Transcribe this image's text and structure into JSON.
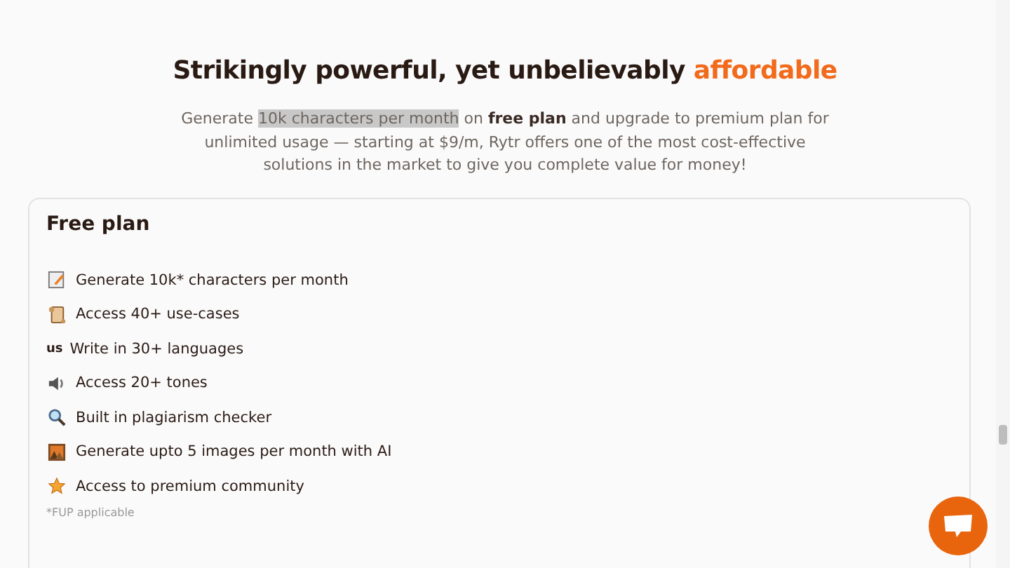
{
  "heading": {
    "text": "Strikingly powerful, yet unbelievably ",
    "accent": "affordable"
  },
  "intro": [
    {
      "text": "Generate ",
      "highlighted": false,
      "bold": false
    },
    {
      "text": "10k characters per month",
      "highlighted": true,
      "bold": false
    },
    {
      "text": " on ",
      "highlighted": false,
      "bold": false
    },
    {
      "text": "free plan",
      "highlighted": false,
      "bold": true
    },
    {
      "text": " and upgrade to premium plan for unlimited usage — starting at $9/m, Rytr offers one of the most cost-effective solutions in the market to give you complete value for money!",
      "highlighted": false,
      "bold": false
    }
  ],
  "plan": {
    "title": "Free plan",
    "features": [
      {
        "kind": "note",
        "label": "Generate 10k* characters per month"
      },
      {
        "kind": "scroll",
        "label": "Access 40+ use-cases"
      },
      {
        "kind": "text",
        "icon_text": "us",
        "label": "Write in 30+ languages"
      },
      {
        "kind": "speaker",
        "label": "Access 20+ tones"
      },
      {
        "kind": "search",
        "label": "Built in plagiarism checker"
      },
      {
        "kind": "frame",
        "label": "Generate upto 5 images per month with AI"
      },
      {
        "kind": "star",
        "label": "Access to premium community"
      }
    ],
    "footnote": "*FUP applicable"
  }
}
